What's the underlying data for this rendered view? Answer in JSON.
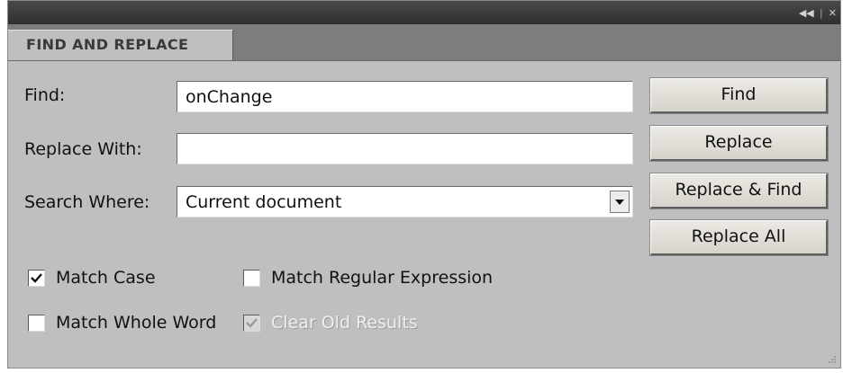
{
  "panel": {
    "tab_label": "FIND AND REPLACE",
    "controls_label": "◀◀ |  ✕"
  },
  "form": {
    "find_label": "Find:",
    "find_value": "onChange",
    "replace_label": "Replace With:",
    "replace_value": "",
    "search_label": "Search Where:",
    "search_value": "Current document"
  },
  "buttons": {
    "find": "Find",
    "replace": "Replace",
    "replace_find": "Replace & Find",
    "replace_all": "Replace All"
  },
  "options": {
    "match_case": {
      "label": "Match Case",
      "checked": true
    },
    "match_regex": {
      "label": "Match Regular Expression",
      "checked": false
    },
    "match_whole_word": {
      "label": "Match Whole Word",
      "checked": false
    },
    "clear_old_results": {
      "label": "Clear Old Results",
      "checked": true,
      "disabled": true
    }
  }
}
